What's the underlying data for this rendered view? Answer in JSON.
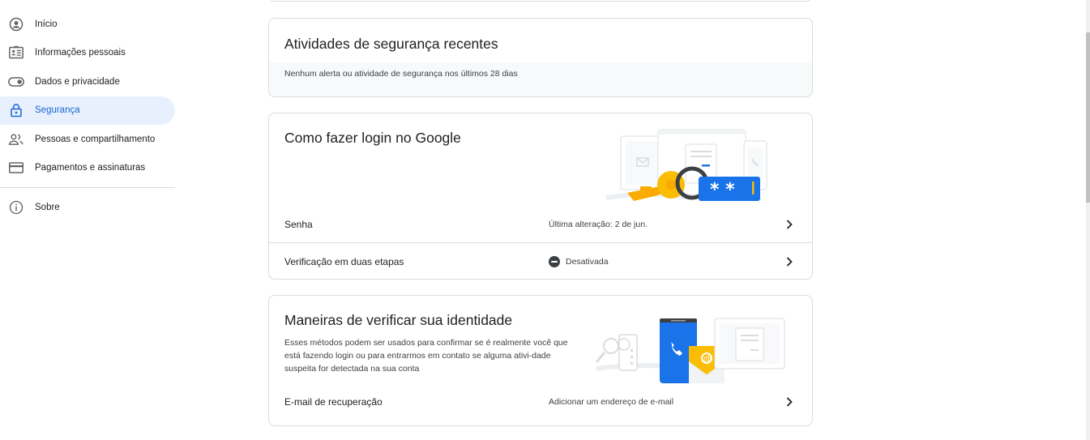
{
  "sidebar": {
    "items": [
      {
        "label": "Início",
        "icon": "account-circle-icon"
      },
      {
        "label": "Informações pessoais",
        "icon": "id-card-icon"
      },
      {
        "label": "Dados e privacidade",
        "icon": "toggle-icon"
      },
      {
        "label": "Segurança",
        "icon": "lock-icon",
        "active": true
      },
      {
        "label": "Pessoas e compartilhamento",
        "icon": "people-icon"
      },
      {
        "label": "Pagamentos e assinaturas",
        "icon": "credit-card-icon"
      },
      {
        "label": "Sobre",
        "icon": "info-icon"
      }
    ]
  },
  "activity": {
    "title": "Atividades de segurança recentes",
    "note": "Nenhum alerta ou atividade de segurança nos últimos 28 dias"
  },
  "login": {
    "title": "Como fazer login no Google",
    "rows": [
      {
        "label": "Senha",
        "value": "Última alteração: 2 de jun."
      },
      {
        "label": "Verificação em duas etapas",
        "value": "Desativada"
      }
    ]
  },
  "identity": {
    "title": "Maneiras de verificar sua identidade",
    "description": "Esses métodos podem ser usados para confirmar se é realmente você que está fazendo login ou para entrarmos em contato se alguma ativi-dade suspeita for detectada na sua conta",
    "rows": [
      {
        "label": "E-mail de recuperação",
        "value": "Adicionar um endereço de e-mail"
      }
    ]
  },
  "colors": {
    "accent": "#1a73e8",
    "active_bg": "#e8f0fe",
    "active_text": "#1967d2",
    "border": "#dadce0"
  }
}
